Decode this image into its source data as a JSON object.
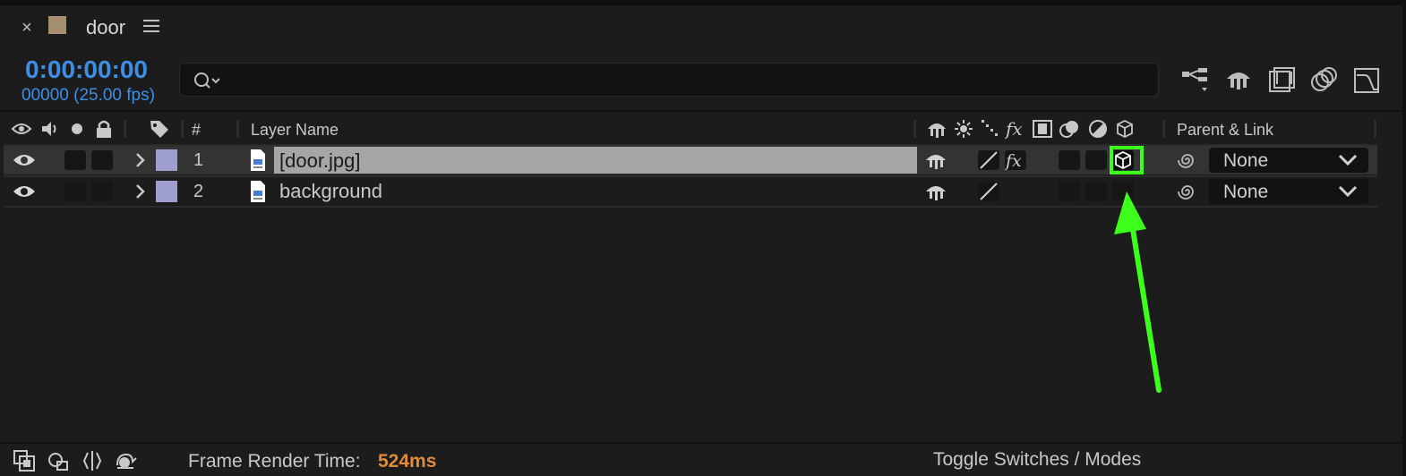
{
  "tab": {
    "close": "×",
    "title": "door"
  },
  "time": {
    "timecode": "0:00:00:00",
    "frames": "00000 (25.00 fps)"
  },
  "search": {
    "placeholder": ""
  },
  "header": {
    "number": "#",
    "layer_name": "Layer Name",
    "parent_link": "Parent & Link"
  },
  "layers": [
    {
      "number": "1",
      "name": "[door.jpg]",
      "selected": true,
      "label_color": "#9f9fcf",
      "parent": "None",
      "fx": true,
      "three_d": true
    },
    {
      "number": "2",
      "name": "background",
      "selected": false,
      "label_color": "#9f9fcf",
      "parent": "None",
      "fx": false,
      "three_d": false
    }
  ],
  "footer": {
    "render_label": "Frame Render Time:",
    "render_value": "524ms",
    "toggle": "Toggle Switches / Modes"
  },
  "colors": {
    "accent": "#3d8fe6",
    "highlight": "#3cff1c",
    "render_time": "#e08a3a",
    "tab_swatch": "#a38f6e"
  }
}
